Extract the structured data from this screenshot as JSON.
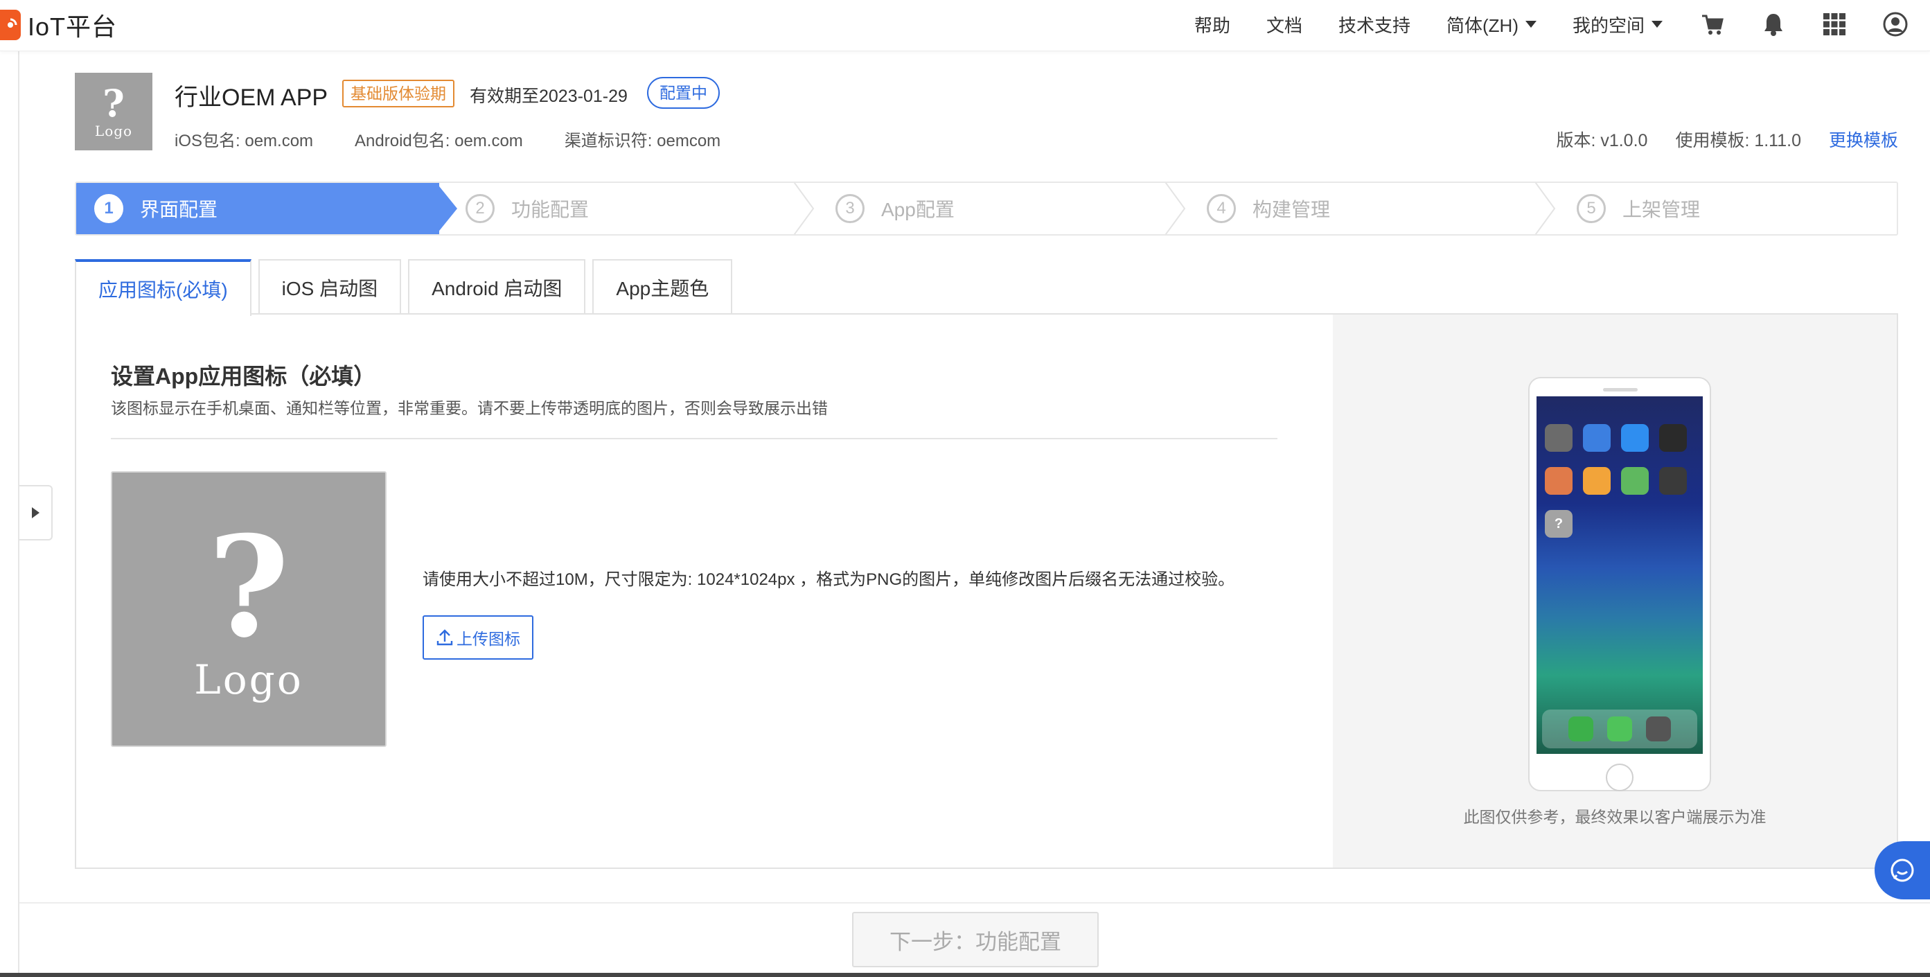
{
  "topbar": {
    "brand": "IoT平台",
    "links": [
      "帮助",
      "文档",
      "技术支持"
    ],
    "language": "简体(ZH)",
    "workspace": "我的空间",
    "icons": [
      "cart-icon",
      "bell-icon",
      "apps-grid-icon",
      "user-icon"
    ]
  },
  "app": {
    "logo_text": "Logo",
    "title": "行业OEM APP",
    "trial_badge": "基础版体验期",
    "validity": "有效期至2023-01-29",
    "status": "配置中",
    "ios_package": "iOS包名: oem.com",
    "android_package": "Android包名: oem.com",
    "channel": "渠道标识符: oemcom",
    "version": "版本: v1.0.0",
    "template": "使用模板: 1.11.0",
    "change_template": "更换模板"
  },
  "steps": [
    {
      "num": "1",
      "label": "界面配置",
      "active": true
    },
    {
      "num": "2",
      "label": "功能配置",
      "active": false
    },
    {
      "num": "3",
      "label": "App配置",
      "active": false
    },
    {
      "num": "4",
      "label": "构建管理",
      "active": false
    },
    {
      "num": "5",
      "label": "上架管理",
      "active": false
    }
  ],
  "tabs": [
    {
      "label": "应用图标(必填)",
      "active": true
    },
    {
      "label": "iOS 启动图",
      "active": false
    },
    {
      "label": "Android 启动图",
      "active": false
    },
    {
      "label": "App主题色",
      "active": false
    }
  ],
  "icon_section": {
    "title": "设置App应用图标（必填）",
    "description": "该图标显示在手机桌面、通知栏等位置，非常重要。请不要上传带透明底的图片，否则会导致展示出错",
    "placeholder_logo": "Logo",
    "requirements": "请使用大小不超过10M，尺寸限定为: 1024*1024px ，格式为PNG的图片，单纯修改图片后缀名无法通过校验。",
    "upload_button": "上传图标"
  },
  "preview": {
    "note": "此图仅供参考，最终效果以客户端展示为准"
  },
  "footer": {
    "next_button": "下一步：功能配置"
  },
  "colors": {
    "primary": "#2e6bdf",
    "step_active": "#5b8ff0",
    "brand": "#f05a22",
    "trial": "#e38a32"
  }
}
